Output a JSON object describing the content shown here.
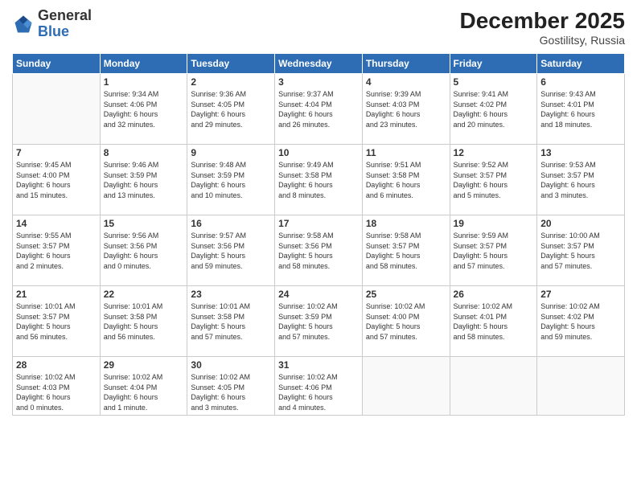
{
  "header": {
    "logo": {
      "general": "General",
      "blue": "Blue"
    },
    "title": "December 2025",
    "location": "Gostilitsy, Russia"
  },
  "weekdays": [
    "Sunday",
    "Monday",
    "Tuesday",
    "Wednesday",
    "Thursday",
    "Friday",
    "Saturday"
  ],
  "weeks": [
    [
      {
        "day": "",
        "info": ""
      },
      {
        "day": "1",
        "info": "Sunrise: 9:34 AM\nSunset: 4:06 PM\nDaylight: 6 hours\nand 32 minutes."
      },
      {
        "day": "2",
        "info": "Sunrise: 9:36 AM\nSunset: 4:05 PM\nDaylight: 6 hours\nand 29 minutes."
      },
      {
        "day": "3",
        "info": "Sunrise: 9:37 AM\nSunset: 4:04 PM\nDaylight: 6 hours\nand 26 minutes."
      },
      {
        "day": "4",
        "info": "Sunrise: 9:39 AM\nSunset: 4:03 PM\nDaylight: 6 hours\nand 23 minutes."
      },
      {
        "day": "5",
        "info": "Sunrise: 9:41 AM\nSunset: 4:02 PM\nDaylight: 6 hours\nand 20 minutes."
      },
      {
        "day": "6",
        "info": "Sunrise: 9:43 AM\nSunset: 4:01 PM\nDaylight: 6 hours\nand 18 minutes."
      }
    ],
    [
      {
        "day": "7",
        "info": "Sunrise: 9:45 AM\nSunset: 4:00 PM\nDaylight: 6 hours\nand 15 minutes."
      },
      {
        "day": "8",
        "info": "Sunrise: 9:46 AM\nSunset: 3:59 PM\nDaylight: 6 hours\nand 13 minutes."
      },
      {
        "day": "9",
        "info": "Sunrise: 9:48 AM\nSunset: 3:59 PM\nDaylight: 6 hours\nand 10 minutes."
      },
      {
        "day": "10",
        "info": "Sunrise: 9:49 AM\nSunset: 3:58 PM\nDaylight: 6 hours\nand 8 minutes."
      },
      {
        "day": "11",
        "info": "Sunrise: 9:51 AM\nSunset: 3:58 PM\nDaylight: 6 hours\nand 6 minutes."
      },
      {
        "day": "12",
        "info": "Sunrise: 9:52 AM\nSunset: 3:57 PM\nDaylight: 6 hours\nand 5 minutes."
      },
      {
        "day": "13",
        "info": "Sunrise: 9:53 AM\nSunset: 3:57 PM\nDaylight: 6 hours\nand 3 minutes."
      }
    ],
    [
      {
        "day": "14",
        "info": "Sunrise: 9:55 AM\nSunset: 3:57 PM\nDaylight: 6 hours\nand 2 minutes."
      },
      {
        "day": "15",
        "info": "Sunrise: 9:56 AM\nSunset: 3:56 PM\nDaylight: 6 hours\nand 0 minutes."
      },
      {
        "day": "16",
        "info": "Sunrise: 9:57 AM\nSunset: 3:56 PM\nDaylight: 5 hours\nand 59 minutes."
      },
      {
        "day": "17",
        "info": "Sunrise: 9:58 AM\nSunset: 3:56 PM\nDaylight: 5 hours\nand 58 minutes."
      },
      {
        "day": "18",
        "info": "Sunrise: 9:58 AM\nSunset: 3:57 PM\nDaylight: 5 hours\nand 58 minutes."
      },
      {
        "day": "19",
        "info": "Sunrise: 9:59 AM\nSunset: 3:57 PM\nDaylight: 5 hours\nand 57 minutes."
      },
      {
        "day": "20",
        "info": "Sunrise: 10:00 AM\nSunset: 3:57 PM\nDaylight: 5 hours\nand 57 minutes."
      }
    ],
    [
      {
        "day": "21",
        "info": "Sunrise: 10:01 AM\nSunset: 3:57 PM\nDaylight: 5 hours\nand 56 minutes."
      },
      {
        "day": "22",
        "info": "Sunrise: 10:01 AM\nSunset: 3:58 PM\nDaylight: 5 hours\nand 56 minutes."
      },
      {
        "day": "23",
        "info": "Sunrise: 10:01 AM\nSunset: 3:58 PM\nDaylight: 5 hours\nand 57 minutes."
      },
      {
        "day": "24",
        "info": "Sunrise: 10:02 AM\nSunset: 3:59 PM\nDaylight: 5 hours\nand 57 minutes."
      },
      {
        "day": "25",
        "info": "Sunrise: 10:02 AM\nSunset: 4:00 PM\nDaylight: 5 hours\nand 57 minutes."
      },
      {
        "day": "26",
        "info": "Sunrise: 10:02 AM\nSunset: 4:01 PM\nDaylight: 5 hours\nand 58 minutes."
      },
      {
        "day": "27",
        "info": "Sunrise: 10:02 AM\nSunset: 4:02 PM\nDaylight: 5 hours\nand 59 minutes."
      }
    ],
    [
      {
        "day": "28",
        "info": "Sunrise: 10:02 AM\nSunset: 4:03 PM\nDaylight: 6 hours\nand 0 minutes."
      },
      {
        "day": "29",
        "info": "Sunrise: 10:02 AM\nSunset: 4:04 PM\nDaylight: 6 hours\nand 1 minute."
      },
      {
        "day": "30",
        "info": "Sunrise: 10:02 AM\nSunset: 4:05 PM\nDaylight: 6 hours\nand 3 minutes."
      },
      {
        "day": "31",
        "info": "Sunrise: 10:02 AM\nSunset: 4:06 PM\nDaylight: 6 hours\nand 4 minutes."
      },
      {
        "day": "",
        "info": ""
      },
      {
        "day": "",
        "info": ""
      },
      {
        "day": "",
        "info": ""
      }
    ]
  ]
}
